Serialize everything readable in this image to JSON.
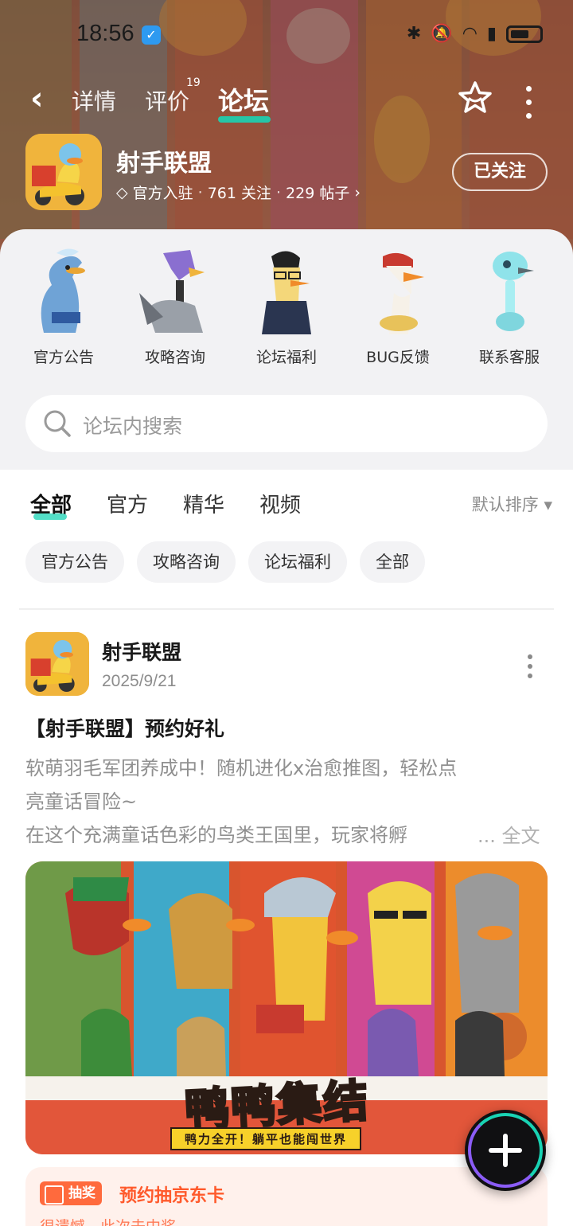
{
  "status_bar": {
    "time": "18:56"
  },
  "nav": {
    "tabs": [
      {
        "label": "详情"
      },
      {
        "label": "评价",
        "badge": "19"
      },
      {
        "label": "论坛",
        "active": true
      }
    ]
  },
  "game": {
    "title": "射手联盟",
    "meta": {
      "official": "官方入驻",
      "follows": "761 关注",
      "posts": "229 帖子"
    },
    "follow_label": "已关注"
  },
  "shortcuts": [
    {
      "label": "官方公告"
    },
    {
      "label": "攻略咨询"
    },
    {
      "label": "论坛福利"
    },
    {
      "label": "BUG反馈"
    },
    {
      "label": "联系客服"
    }
  ],
  "search": {
    "placeholder": "论坛内搜索"
  },
  "feed_tabs": [
    {
      "label": "全部",
      "active": true
    },
    {
      "label": "官方"
    },
    {
      "label": "精华"
    },
    {
      "label": "视频"
    }
  ],
  "sort_label": "默认排序 ▾",
  "chips": [
    {
      "label": "官方公告"
    },
    {
      "label": "攻略咨询"
    },
    {
      "label": "论坛福利"
    },
    {
      "label": "全部"
    }
  ],
  "post": {
    "author": "射手联盟",
    "date": "2025/9/21",
    "title": "【射手联盟】预约好礼",
    "body_lines": [
      "软萌羽毛军团养成中！随机进化x治愈推图，轻松点",
      "亮童话冒险~",
      "在这个充满童话色彩的鸟类王国里，玩家将孵"
    ],
    "more_label": "... 全文",
    "image": {
      "headline": "鸭鸭集结",
      "subline": "鸭力全开！躺平也能闯世界"
    },
    "lottery": {
      "badge": "抽奖",
      "title": "预约抽京东卡",
      "subtitle": "很遗憾，此次未中奖"
    }
  },
  "colors": {
    "accent": "#19d3b4",
    "lottery": "#ff5a2c"
  }
}
